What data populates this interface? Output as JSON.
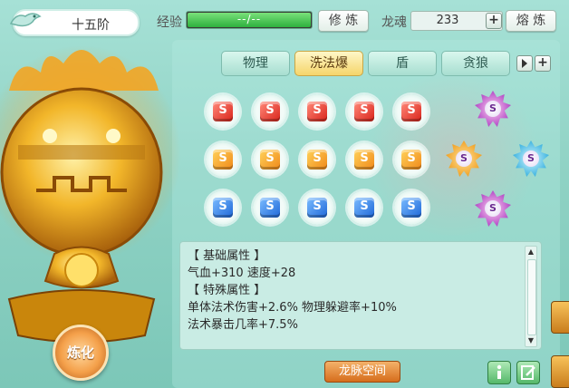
{
  "header": {
    "level": "十五阶",
    "exp_label": "经验",
    "exp_value": "--/--",
    "exp_progress": 1.0,
    "cultivate_button": "修 炼",
    "soul_label": "龙魂",
    "soul_value": "233",
    "smelt_button": "熔 炼"
  },
  "tabs": [
    {
      "label": "物理",
      "active": false
    },
    {
      "label": "洗法爆",
      "active": true
    },
    {
      "label": "盾",
      "active": false
    },
    {
      "label": "贪狼",
      "active": false
    }
  ],
  "gem_rows": [
    {
      "color": "red",
      "count": 5
    },
    {
      "color": "orange",
      "count": 5
    },
    {
      "color": "blue",
      "count": 5
    }
  ],
  "gem_symbol": "S",
  "star_gems": [
    {
      "color": "purple"
    },
    {
      "color": "cyan"
    },
    {
      "color": "orange"
    },
    {
      "color": "purple"
    }
  ],
  "attributes": {
    "basic_header": "【 基础属性 】",
    "basic_line": "气血+310  速度+28",
    "special_header": "【 特殊属性 】",
    "special_line1": "单体法术伤害+2.6%  物理躲避率+10%",
    "special_line2": "法术暴击几率+7.5%"
  },
  "bottom": {
    "dragon_space_button": "龙脉空间",
    "refine_button": "炼化"
  },
  "colors": {
    "background": "#8fd2c4",
    "exp_fill": "#2eb03e",
    "active_tab": "#f5d56a",
    "orange_button": "#d66d1c"
  }
}
